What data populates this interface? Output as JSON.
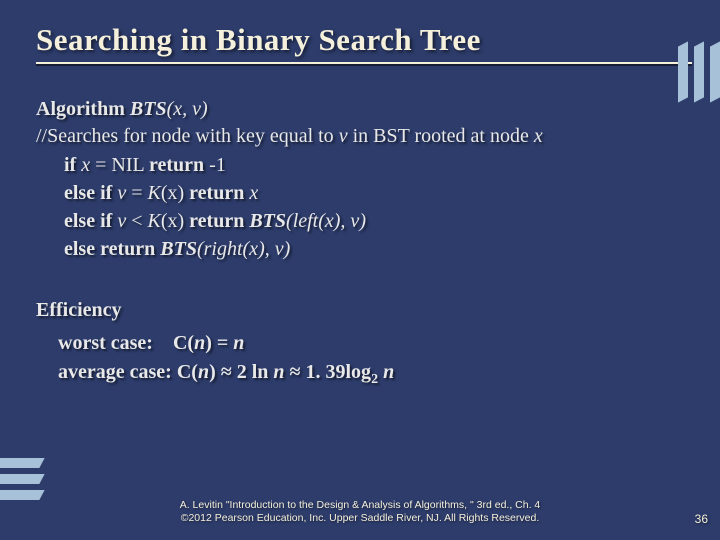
{
  "title": "Searching in Binary Search Tree",
  "algorithm_label": "Algorithm",
  "algo_name": "BTS",
  "algo_params": "(x, v)",
  "algo_comment_prefix": "//Searches for node with key equal to ",
  "algo_comment_var1": "v",
  "algo_comment_mid": " in BST rooted at node ",
  "algo_comment_var2": "x",
  "line1_kw1": "if ",
  "line1_expr1": "x",
  "line1_eq": " = NIL  ",
  "line1_kw2": "return ",
  "line1_val": "-1",
  "line2_kw": "else if  ",
  "line2_v": "v",
  "line2_eq": " = ",
  "line2_k": "K",
  "line2_paren": "(x)  ",
  "line2_ret": "return ",
  "line2_retv": "x",
  "line3_kw": "else if  ",
  "line3_v": "v",
  "line3_lt": " < ",
  "line3_k": "K",
  "line3_paren": "(x)  ",
  "line3_ret": "return ",
  "line3_call": "BTS",
  "line3_args_l": "(left(x), v)",
  "line4_kw": "else return ",
  "line4_call": "BTS",
  "line4_args": "(right(x), v)",
  "eff_heading": "Efficiency",
  "worst_label": "worst case:    ",
  "worst_c": "C(",
  "worst_n": "n",
  "worst_close": ") = ",
  "worst_rhs": "n",
  "avg_label": "average case: ",
  "avg_c": "C(",
  "avg_n": "n",
  "avg_close": ") ≈ 2 ln ",
  "avg_n2": "n",
  "avg_approx": " ≈ 1. 39log",
  "avg_sub": "2",
  "avg_sp": " ",
  "avg_n3": "n",
  "footer_line1": "A. Levitin \"Introduction to the Design & Analysis of Algorithms, \" 3rd ed., Ch. 4",
  "footer_line2": "©2012 Pearson Education, Inc. Upper Saddle River, NJ. All Rights Reserved.",
  "page_number": "36"
}
